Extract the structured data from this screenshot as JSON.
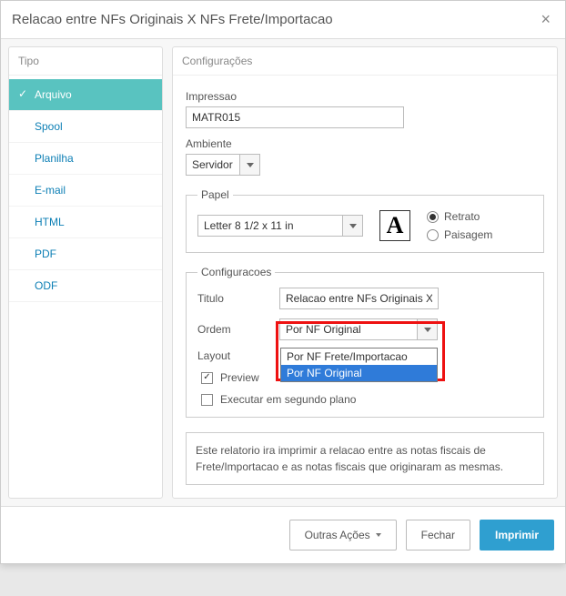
{
  "dialog": {
    "title": "Relacao entre NFs Originais X NFs Frete/Importacao"
  },
  "sidebar": {
    "header": "Tipo",
    "items": [
      {
        "label": "Arquivo",
        "active": true
      },
      {
        "label": "Spool",
        "active": false
      },
      {
        "label": "Planilha",
        "active": false
      },
      {
        "label": "E-mail",
        "active": false
      },
      {
        "label": "HTML",
        "active": false
      },
      {
        "label": "PDF",
        "active": false
      },
      {
        "label": "ODF",
        "active": false
      }
    ]
  },
  "main": {
    "header": "Configurações",
    "impressao": {
      "label": "Impressao",
      "value": "MATR015"
    },
    "ambiente": {
      "label": "Ambiente",
      "value": "Servidor"
    },
    "papel": {
      "legend": "Papel",
      "size": "Letter 8 1/2 x 11 in",
      "orient_icon": "A",
      "retrato": "Retrato",
      "paisagem": "Paisagem",
      "selected": "retrato"
    },
    "config": {
      "legend": "Configuracoes",
      "titulo_label": "Titulo",
      "titulo_value": "Relacao entre NFs Originais X N",
      "ordem_label": "Ordem",
      "ordem_value": "Por NF Original",
      "ordem_options": [
        "Por NF Frete/Importacao",
        "Por NF Original"
      ],
      "layout_label": "Layout",
      "preview_label": "Preview",
      "preview_checked": true,
      "bg_label": "Executar em segundo plano",
      "bg_checked": false
    },
    "description": "Este relatorio ira imprimir a relacao entre as notas fiscais de Frete/Importacao e as notas fiscais que originaram as mesmas."
  },
  "footer": {
    "outras": "Outras Ações",
    "fechar": "Fechar",
    "imprimir": "Imprimir"
  }
}
